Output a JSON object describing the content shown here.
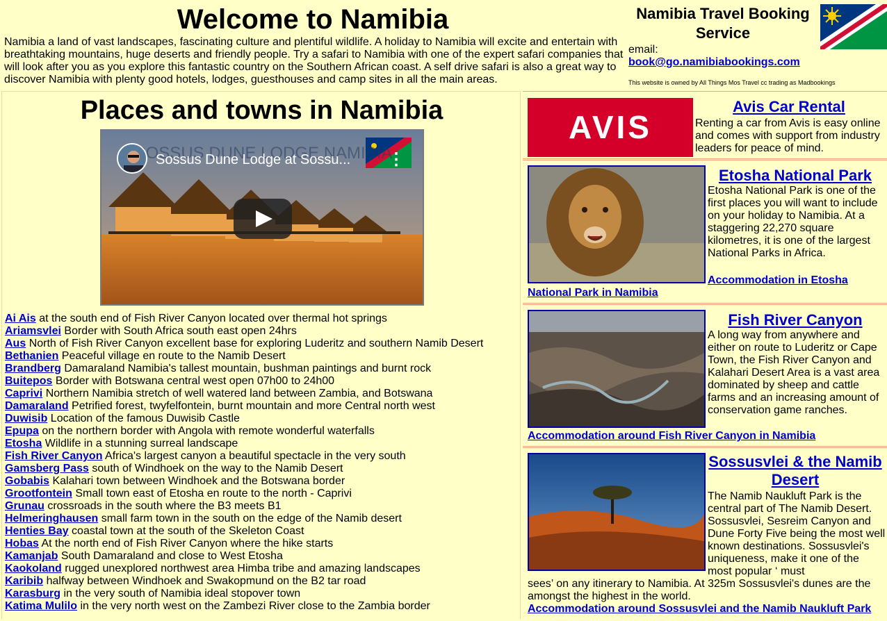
{
  "header": {
    "title": "Welcome to Namibia",
    "intro": "Namibia a land of vast landscapes, fascinating culture and plentiful wildlife. A holiday to Namibia will excite and entertain with breathtaking mountains, huge deserts and friendly people. Try a safari to Namibia with one of the expert safari companies that will look after you as you explore this fantastic country on the Southern African coast. A self drive safari is also a great way to discover Namibia with plenty good hotels, lodges, guesthouses and camp sites in all the main areas.",
    "booking_title": "Namibia Travel Booking Service",
    "email_label": "email:",
    "email": "book@go.namibiabookings.com",
    "owner_note": "This website is owned by All Things Mos Travel cc trading as Madbookings"
  },
  "main": {
    "title": "Places and towns in Namibia",
    "video": {
      "title": "Sossus Dune Lodge at Sossu...",
      "overlay_text": "SOSSUS DUNE LODGE NAMIBIA"
    },
    "places": [
      {
        "name": "Ai Ais",
        "desc": "at the south end of Fish River Canyon located over thermal hot springs"
      },
      {
        "name": "Ariamsvlei",
        "desc": "Border with South Africa south east open 24hrs"
      },
      {
        "name": "Aus",
        "desc": "North of Fish River Canyon excellent base for exploring Luderitz and southern Namib Desert"
      },
      {
        "name": "Bethanien",
        "desc": "Peaceful village en route to the Namib Desert"
      },
      {
        "name": "Brandberg",
        "desc": "Damaraland Namibia's tallest mountain, bushman paintings and burnt rock"
      },
      {
        "name": "Buitepos",
        "desc": "Border with Botswana central west open 07h00 to 24h00"
      },
      {
        "name": "Caprivi",
        "desc": "Northern Namibia stretch of well watered land between Zambia, and Botswana"
      },
      {
        "name": "Damaraland",
        "desc": "Petrified forest, twyfelfontein, burnt mountain and more Central north west"
      },
      {
        "name": "Duwisib",
        "desc": "Location of the famous Duwisib Castle"
      },
      {
        "name": "Epupa",
        "desc": "on the northern border with Angola with remote wonderful waterfalls"
      },
      {
        "name": "Etosha",
        "desc": "Wildlife in a stunning surreal landscape"
      },
      {
        "name": "Fish River Canyon",
        "desc": "Africa's largest canyon a beautiful spectacle in the very south"
      },
      {
        "name": "Gamsberg Pass",
        "desc": "south of Windhoek on the way to the Namib Desert"
      },
      {
        "name": "Gobabis",
        "desc": "Kalahari town between Windhoek and the Botswana border"
      },
      {
        "name": "Grootfontein",
        "desc": "Small town east of Etosha en route to the north - Caprivi"
      },
      {
        "name": "Grunau",
        "desc": "crossroads in the south where the B3 meets B1"
      },
      {
        "name": "Helmeringhausen",
        "desc": "small farm town in the south on the edge of the Namib desert"
      },
      {
        "name": "Henties Bay",
        "desc": "coastal town at the south of the Skeleton Coast"
      },
      {
        "name": "Hobas",
        "desc": "At the north end of Fish River Canyon where the hike starts"
      },
      {
        "name": "Kamanjab",
        "desc": "South Damaraland and close to West Etosha"
      },
      {
        "name": "Kaokoland",
        "desc": "rugged unexplored northwest area Himba tribe and amazing landscapes"
      },
      {
        "name": "Karibib",
        "desc": "halfway between Windhoek and Swakopmund on the B2 tar road"
      },
      {
        "name": "Karasburg",
        "desc": "in the very south of Namibia ideal stopover town"
      },
      {
        "name": "Katima Mulilo",
        "desc": "in the very north west on the Zambezi River close to the Zambia border"
      }
    ]
  },
  "sidebar": {
    "avis": {
      "logo": "AVIS",
      "title": "Avis Car Rental",
      "desc": "Renting a car from Avis is easy online and comes with support from industry leaders for peace of mind."
    },
    "etosha": {
      "title": "Etosha National Park",
      "desc": "Etosha National Park is one of the first places you will want to include on your holiday to Namibia. At a staggering 22,270 square kilometres, it is one of the largest National Parks in Africa.",
      "link_part1": "Accommodation in Etosha",
      "link_part2": "National Park in Namibia"
    },
    "fish": {
      "title": "Fish River Canyon",
      "desc": "A long way from anywhere and either on route to Luderitz or Cape Town, the Fish River Canyon and Kalahari Desert Area is a vast area dominated by sheep and cattle farms and an increasing amount of conservation game ranches.",
      "link": "Accommodation around Fish River Canyon in Namibia"
    },
    "sossus": {
      "title": "Sossusvlei & the Namib Desert",
      "desc": "The Namib Naukluft Park is the central part of The Namib Desert. Sossusvlei, Sesreim Canyon and Dune Forty Five being the most well known destinations. Sossusvlei's uniqueness, make it one of the most popular ‘ must",
      "desc2": "sees’ on any itinerary to Namibia. At 325m Sossusvlei's dunes are the amongst the highest in the world.",
      "link": "Accommodation around Sossusvlei and the Namib Naukluft Park"
    }
  },
  "colors": {
    "page_bg": "#ffffc8",
    "link": "#0000cc",
    "avis_red": "#d4002a"
  }
}
